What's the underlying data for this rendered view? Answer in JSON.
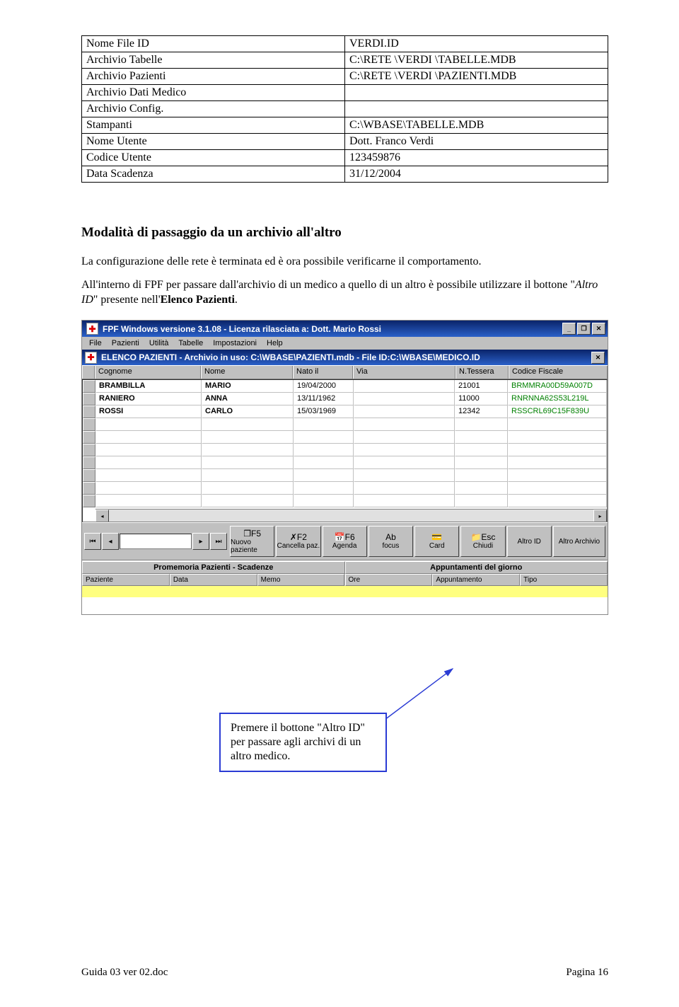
{
  "config_table": {
    "rows": [
      {
        "label": "Nome File ID",
        "value": "VERDI.ID"
      },
      {
        "label": "Archivio Tabelle",
        "value": "C:\\RETE \\VERDI \\TABELLE.MDB"
      },
      {
        "label": "Archivio Pazienti",
        "value": "C:\\RETE \\VERDI \\PAZIENTI.MDB"
      },
      {
        "label": "Archivio Dati Medico",
        "value": ""
      },
      {
        "label": "Archivio Config.",
        "value": ""
      },
      {
        "label": "Stampanti",
        "value": "C:\\WBASE\\TABELLE.MDB"
      },
      {
        "label": "Nome Utente",
        "value": "Dott. Franco Verdi"
      },
      {
        "label": "Codice Utente",
        "value": "123459876"
      },
      {
        "label": "Data Scadenza",
        "value": "31/12/2004"
      }
    ]
  },
  "section_heading": "Modalità di passaggio da un archivio all'altro",
  "paragraph_1": "La configurazione delle rete è terminata ed è ora possibile verificarne il comportamento.",
  "paragraph_2_pre": "All'interno di FPF per passare dall'archivio di un medico a quello di un altro è possibile utilizzare il bottone \"",
  "paragraph_2_italic1": "Altro ID",
  "paragraph_2_mid": "\" presente nell'",
  "paragraph_2_bold": "Elenco Pazienti",
  "paragraph_2_end": ".",
  "app": {
    "title": "FPF Windows versione 3.1.08  -  Licenza rilasciata a: Dott. Mario Rossi",
    "menus": [
      "File",
      "Pazienti",
      "Utilità",
      "Tabelle",
      "Impostazioni",
      "Help"
    ],
    "subtitle": "ELENCO PAZIENTI - Archivio in uso: C:\\WBASE\\PAZIENTI.mdb - File ID:C:\\WBASE\\MEDICO.ID",
    "columns": {
      "cognome": "Cognome",
      "nome": "Nome",
      "nato": "Nato il",
      "via": "Via",
      "tessera": "N.Tessera",
      "cf": "Codice Fiscale"
    },
    "rows": [
      {
        "cognome": "BRAMBILLA",
        "nome": "MARIO",
        "nato": "19/04/2000",
        "via": "",
        "tessera": "21001",
        "cf": "BRMMRA00D59A007D"
      },
      {
        "cognome": "RANIERO",
        "nome": "ANNA",
        "nato": "13/11/1962",
        "via": "",
        "tessera": "11000",
        "cf": "RNRNNA62S53L219L"
      },
      {
        "cognome": "ROSSI",
        "nome": "CARLO",
        "nato": "15/03/1969",
        "via": "",
        "tessera": "12342",
        "cf": "RSSCRL69C15F839U"
      }
    ],
    "toolbar": {
      "nuovo": {
        "shortcut": "❐F5",
        "label": "Nuovo paziente"
      },
      "cancella": {
        "shortcut": "✗F2",
        "label": "Cancella paz."
      },
      "agenda": {
        "shortcut": "📅F6",
        "label": "Agenda"
      },
      "focus": {
        "shortcut": "Ab",
        "label": "focus"
      },
      "card": {
        "shortcut": "💳",
        "label": "Card"
      },
      "chiudi": {
        "shortcut": "📁Esc",
        "label": "Chiudi"
      },
      "altroid": {
        "label": "Altro ID"
      },
      "altroarch": {
        "label": "Altro Archivio"
      }
    },
    "memo": {
      "left_title": "Promemoria Pazienti - Scadenze",
      "right_title": "Appuntamenti del giorno",
      "left_cols": [
        "Paziente",
        "Data",
        "Memo"
      ],
      "right_cols": [
        "Ore",
        "Appuntamento",
        "Tipo"
      ]
    }
  },
  "callout_text": "Premere il bottone \"Altro ID\" per passare agli archivi di un altro medico.",
  "footer": {
    "left": "Guida 03 ver 02.doc",
    "right": "Pagina 16"
  }
}
